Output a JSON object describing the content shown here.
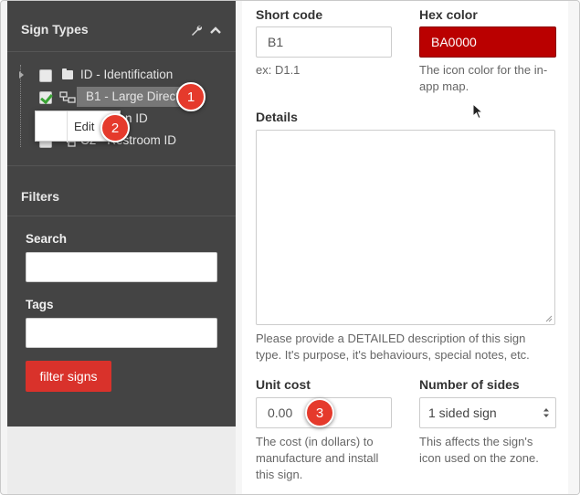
{
  "sidebar": {
    "sign_types_title": "Sign Types",
    "tree": [
      {
        "label": "ID - Identification",
        "checked": false,
        "icon": "folder-icon"
      },
      {
        "label": "B1 - Large Directi",
        "checked": true,
        "icon": "sign-icon",
        "selected": true
      },
      {
        "label": "n ID",
        "checked": false,
        "icon": "sign-icon"
      },
      {
        "label": "C2 - Restroom ID",
        "checked": false,
        "icon": "sign-icon"
      }
    ],
    "context_menu": {
      "edit_label": "Edit"
    },
    "filters_title": "Filters",
    "search_label": "Search",
    "search_value": "",
    "tags_label": "Tags",
    "tags_value": "",
    "filter_button": "filter signs"
  },
  "form": {
    "short_code_label": "Short code",
    "short_code_value": "B1",
    "short_code_help": "ex: D1.1",
    "hex_color_label": "Hex color",
    "hex_color_value": "BA0000",
    "hex_color_help_1": "The icon color for the in-",
    "hex_color_help_2": "app map.",
    "details_label": "Details",
    "details_value": "",
    "details_help_1": "Please provide a DETAILED description of this sign",
    "details_help_2": "type. It's purpose, it's behaviours, special notes, etc.",
    "unit_cost_label": "Unit cost",
    "unit_cost_value": "0.00",
    "unit_cost_help_1": "The cost (in dollars) to",
    "unit_cost_help_2": "manufacture and install",
    "unit_cost_help_3": "this sign.",
    "sides_label": "Number of sides",
    "sides_value": "1 sided sign",
    "sides_help_1": "This affects the sign's",
    "sides_help_2": "icon used on the zone."
  },
  "annotations": {
    "step1": "1",
    "step2": "2",
    "step3": "3"
  },
  "colors": {
    "accent_red": "#d9322b",
    "hex_swatch": "#BA0000",
    "sidebar_bg": "#444444",
    "badge": "#e53a2c"
  }
}
